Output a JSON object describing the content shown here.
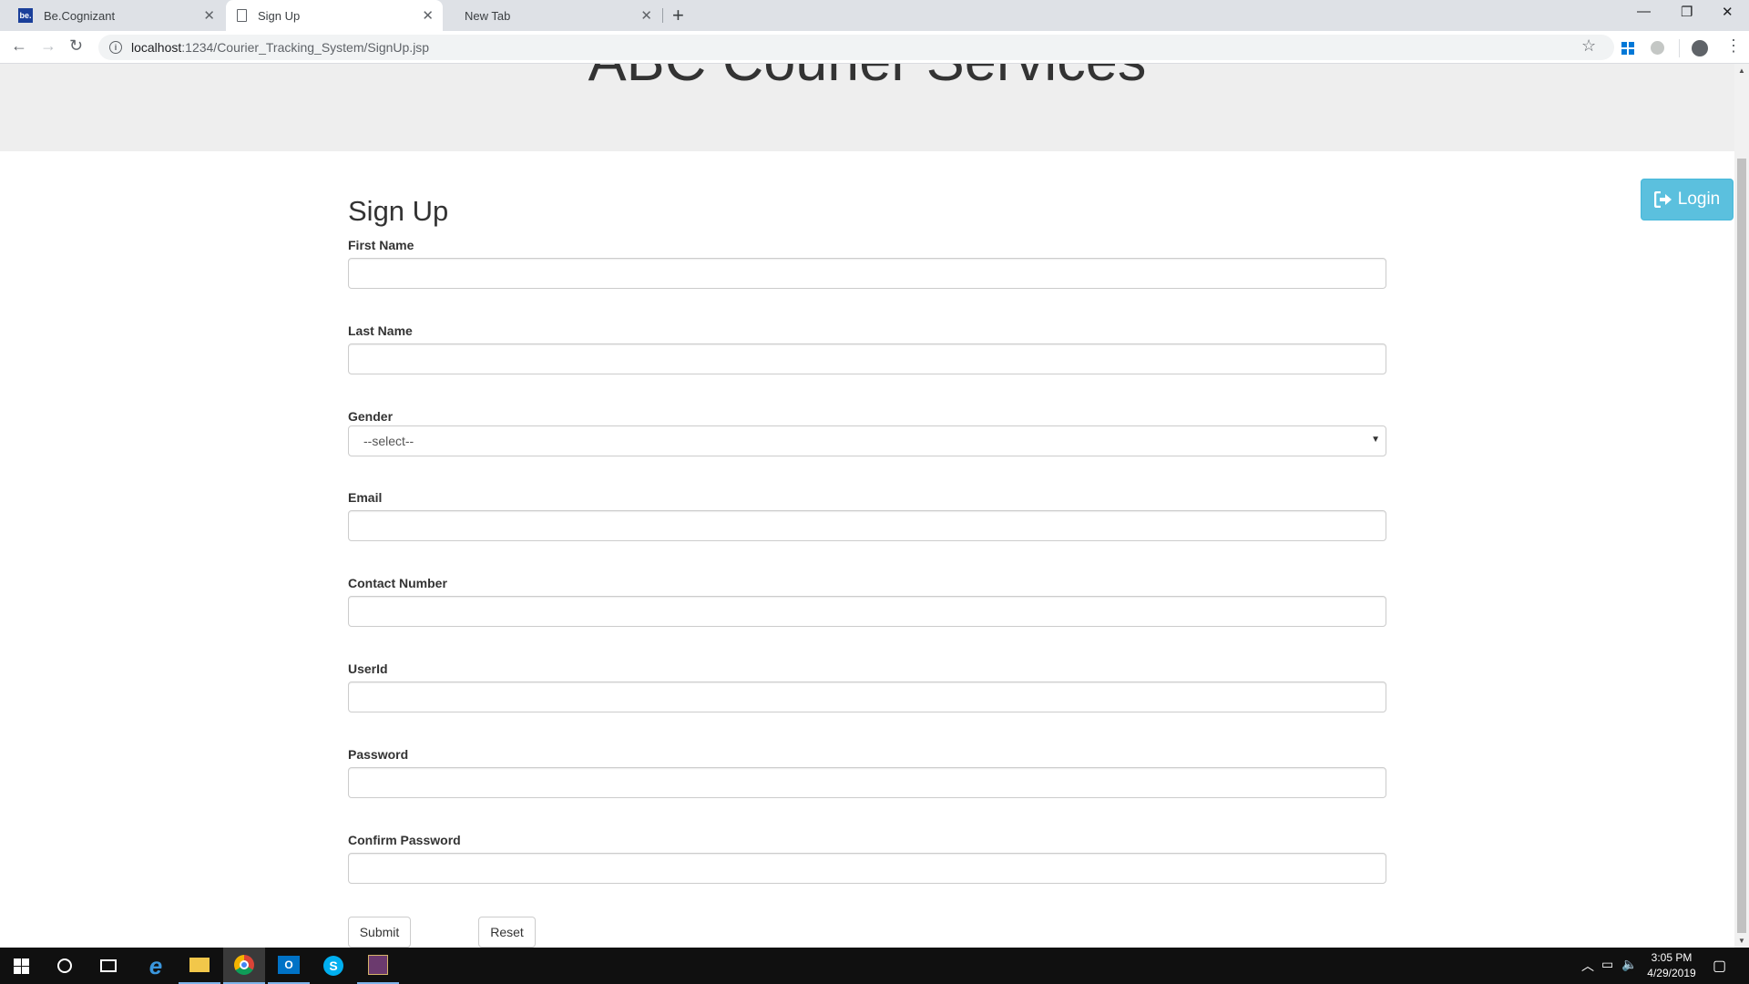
{
  "browser": {
    "tabs": [
      {
        "title": "Be.Cognizant",
        "favicon_text": "be.",
        "active": false
      },
      {
        "title": "Sign Up",
        "active": true
      },
      {
        "title": "New Tab",
        "active": false
      }
    ],
    "url_host": "localhost",
    "url_path": ":1234/Courier_Tracking_System/SignUp.jsp"
  },
  "page": {
    "site_title": "ABC Courier Services",
    "login_label": "Login",
    "form_title": "Sign Up",
    "fields": {
      "first_name": {
        "label": "First Name",
        "value": ""
      },
      "last_name": {
        "label": "Last Name",
        "value": ""
      },
      "gender": {
        "label": "Gender",
        "selected": "--select--"
      },
      "email": {
        "label": "Email",
        "value": ""
      },
      "contact": {
        "label": "Contact Number",
        "value": ""
      },
      "userid": {
        "label": "UserId",
        "value": ""
      },
      "password": {
        "label": "Password",
        "value": ""
      },
      "confirm_password": {
        "label": "Confirm Password",
        "value": ""
      }
    },
    "submit_label": "Submit",
    "reset_label": "Reset"
  },
  "taskbar": {
    "time": "3:05 PM",
    "date": "4/29/2019"
  },
  "colors": {
    "login_button": "#5bc0de",
    "jumbotron": "#eeeeee",
    "taskbar": "#101010"
  }
}
